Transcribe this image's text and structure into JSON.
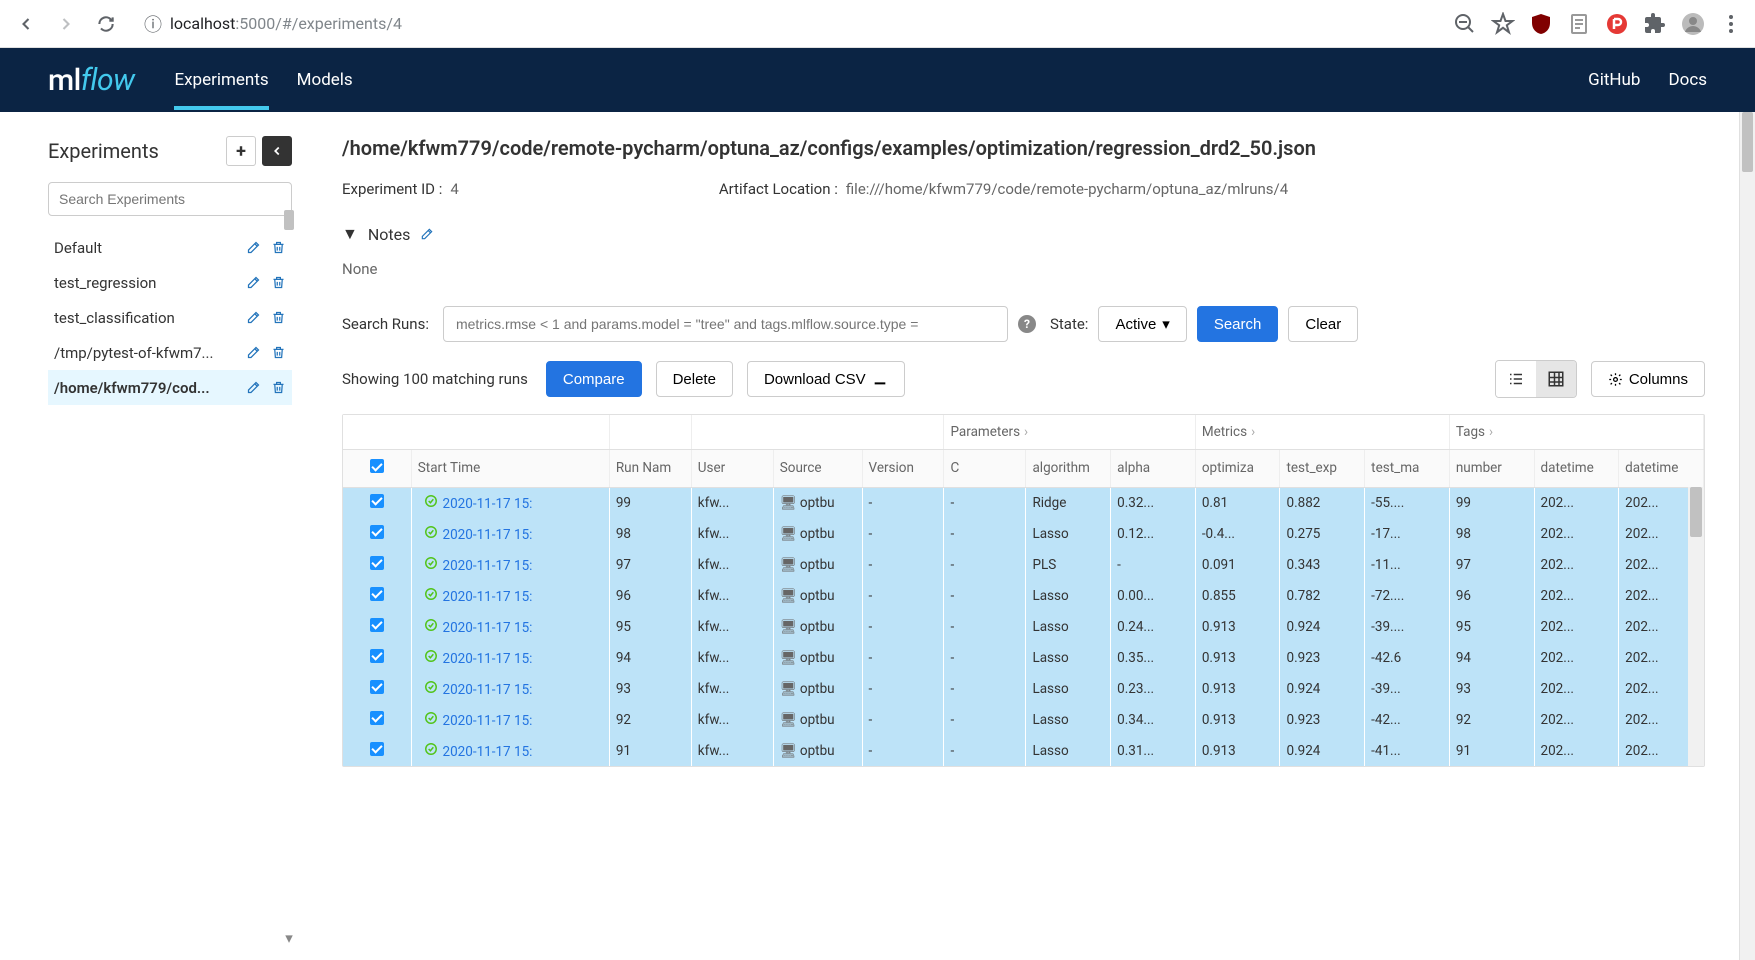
{
  "browser": {
    "url_info": "ⓘ",
    "url_host": "localhost",
    "url_port": ":5000",
    "url_path": "/#/experiments/4"
  },
  "nav": {
    "logo_ml": "ml",
    "logo_flow": "flow",
    "tab_experiments": "Experiments",
    "tab_models": "Models",
    "link_github": "GitHub",
    "link_docs": "Docs"
  },
  "sidebar": {
    "title": "Experiments",
    "search_placeholder": "Search Experiments",
    "items": [
      {
        "name": "Default",
        "selected": false
      },
      {
        "name": "test_regression",
        "selected": false
      },
      {
        "name": "test_classification",
        "selected": false
      },
      {
        "name": "/tmp/pytest-of-kfwm7...",
        "selected": false
      },
      {
        "name": "/home/kfwm779/cod...",
        "selected": true
      }
    ]
  },
  "exp": {
    "title": "/home/kfwm779/code/remote-pycharm/optuna_az/configs/examples/optimization/regression_drd2_50.json",
    "id_label": "Experiment ID :",
    "id_value": "4",
    "artifact_label": "Artifact Location :",
    "artifact_value": "file:///home/kfwm779/code/remote-pycharm/optuna_az/mlruns/4",
    "notes_label": "Notes",
    "notes_value": "None",
    "search_label": "Search Runs:",
    "search_placeholder": "metrics.rmse < 1 and params.model = \"tree\" and tags.mlflow.source.type = ",
    "state_label": "State:",
    "state_value": "Active",
    "search_btn": "Search",
    "clear_btn": "Clear",
    "matching": "Showing 100 matching runs",
    "compare_btn": "Compare",
    "delete_btn": "Delete",
    "download_btn": "Download CSV",
    "columns_btn": "Columns"
  },
  "table": {
    "group_params": "Parameters",
    "group_metrics": "Metrics",
    "group_tags": "Tags",
    "cols": {
      "start": "Start Time",
      "run": "Run Nam",
      "user": "User",
      "source": "Source",
      "version": "Version",
      "c": "C",
      "algorithm": "algorithm",
      "alpha": "alpha",
      "optimiz": "optimiza",
      "test_exp": "test_exp",
      "test_max": "test_ma",
      "number": "number",
      "dt1": "datetime",
      "dt2": "datetime"
    },
    "rows": [
      {
        "start": "2020-11-17 15:",
        "run": "99",
        "user": "kfw...",
        "src": "optbu",
        "ver": "-",
        "c": "-",
        "alg": "Ridge",
        "alpha": "0.32...",
        "opt": "0.81",
        "texp": "0.882",
        "tmax": "-55....",
        "num": "99",
        "d1": "202...",
        "d2": "202..."
      },
      {
        "start": "2020-11-17 15:",
        "run": "98",
        "user": "kfw...",
        "src": "optbu",
        "ver": "-",
        "c": "-",
        "alg": "Lasso",
        "alpha": "0.12...",
        "opt": "-0.4...",
        "texp": "0.275",
        "tmax": "-17...",
        "num": "98",
        "d1": "202...",
        "d2": "202..."
      },
      {
        "start": "2020-11-17 15:",
        "run": "97",
        "user": "kfw...",
        "src": "optbu",
        "ver": "-",
        "c": "-",
        "alg": "PLS",
        "alpha": "-",
        "opt": "0.091",
        "texp": "0.343",
        "tmax": "-11...",
        "num": "97",
        "d1": "202...",
        "d2": "202..."
      },
      {
        "start": "2020-11-17 15:",
        "run": "96",
        "user": "kfw...",
        "src": "optbu",
        "ver": "-",
        "c": "-",
        "alg": "Lasso",
        "alpha": "0.00...",
        "opt": "0.855",
        "texp": "0.782",
        "tmax": "-72....",
        "num": "96",
        "d1": "202...",
        "d2": "202..."
      },
      {
        "start": "2020-11-17 15:",
        "run": "95",
        "user": "kfw...",
        "src": "optbu",
        "ver": "-",
        "c": "-",
        "alg": "Lasso",
        "alpha": "0.24...",
        "opt": "0.913",
        "texp": "0.924",
        "tmax": "-39....",
        "num": "95",
        "d1": "202...",
        "d2": "202..."
      },
      {
        "start": "2020-11-17 15:",
        "run": "94",
        "user": "kfw...",
        "src": "optbu",
        "ver": "-",
        "c": "-",
        "alg": "Lasso",
        "alpha": "0.35...",
        "opt": "0.913",
        "texp": "0.923",
        "tmax": "-42.6",
        "num": "94",
        "d1": "202...",
        "d2": "202..."
      },
      {
        "start": "2020-11-17 15:",
        "run": "93",
        "user": "kfw...",
        "src": "optbu",
        "ver": "-",
        "c": "-",
        "alg": "Lasso",
        "alpha": "0.23...",
        "opt": "0.913",
        "texp": "0.924",
        "tmax": "-39...",
        "num": "93",
        "d1": "202...",
        "d2": "202..."
      },
      {
        "start": "2020-11-17 15:",
        "run": "92",
        "user": "kfw...",
        "src": "optbu",
        "ver": "-",
        "c": "-",
        "alg": "Lasso",
        "alpha": "0.34...",
        "opt": "0.913",
        "texp": "0.923",
        "tmax": "-42...",
        "num": "92",
        "d1": "202...",
        "d2": "202..."
      },
      {
        "start": "2020-11-17 15:",
        "run": "91",
        "user": "kfw...",
        "src": "optbu",
        "ver": "-",
        "c": "-",
        "alg": "Lasso",
        "alpha": "0.31...",
        "opt": "0.913",
        "texp": "0.924",
        "tmax": "-41...",
        "num": "91",
        "d1": "202...",
        "d2": "202..."
      }
    ]
  }
}
